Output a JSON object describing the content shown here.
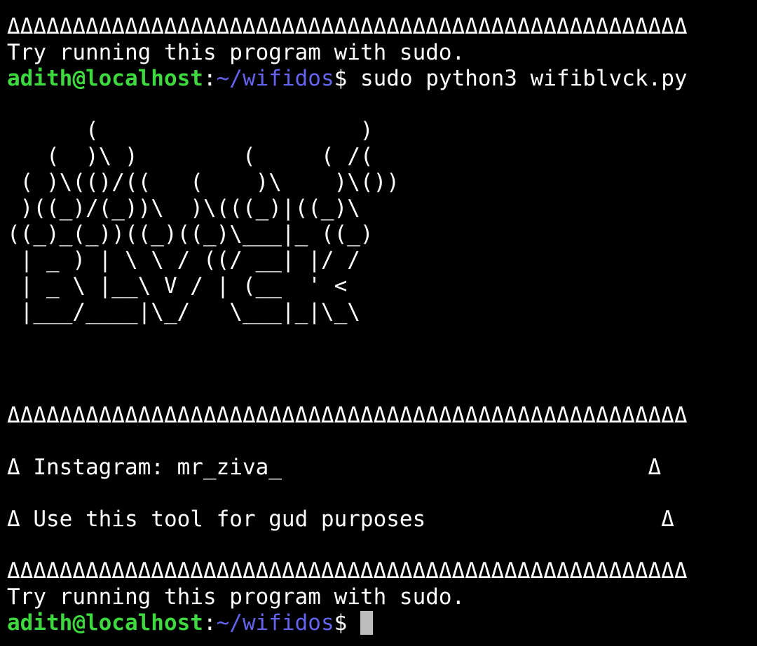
{
  "prompt": {
    "user_host": "adith@localhost",
    "separator": ":",
    "path": "~/wifidos",
    "symbol": "$"
  },
  "lines": {
    "border": "ΔΔΔΔΔΔΔΔΔΔΔΔΔΔΔΔΔΔΔΔΔΔΔΔΔΔΔΔΔΔΔΔΔΔΔΔΔΔΔΔΔΔΔΔΔΔΔΔΔΔΔΔ",
    "sudo_notice": "Try running this program with sudo.",
    "command": " sudo python3 wifiblvck.py",
    "banner": [
      "      (                    )",
      "   (  )\\ )        (     ( /(",
      " ( )\\(()/((   (    )\\    )\\())",
      " )((_)/(_))\\  )\\(((_)|((_)\\",
      "((_)_(_))((_)((_)\\___|_ ((_)",
      " | _ ) | \\ \\ / ((/ __| |/ /",
      " | _ \\ |__\\ V / | (__  ' <",
      " |___/____|\\_/   \\___|_|\\_\\"
    ],
    "instagram": "Δ Instagram: mr_ziva_                            Δ",
    "purpose": "Δ Use this tool for gud purposes                  Δ"
  }
}
